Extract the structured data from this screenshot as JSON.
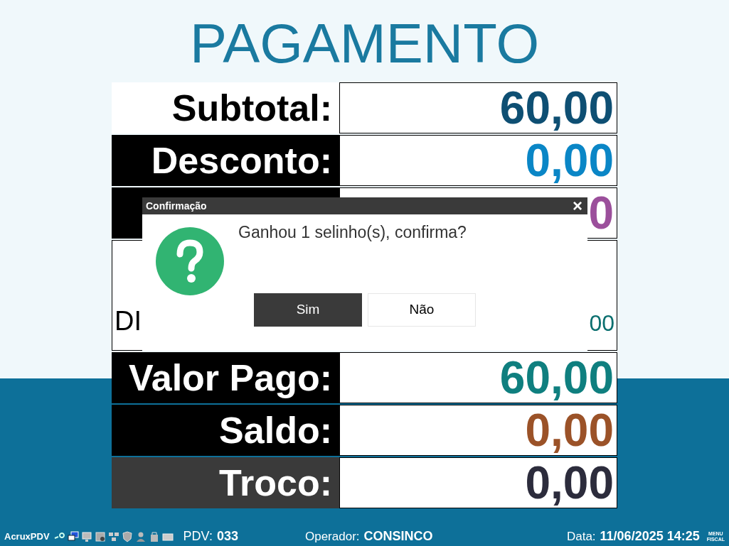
{
  "title": "PAGAMENTO",
  "rows": [
    {
      "kind": "plain",
      "label": "Subtotal:",
      "value": "60,00",
      "color": "#0e4f73"
    },
    {
      "kind": "dark",
      "label": "Desconto:",
      "value": "0,00",
      "color": "#0a86c6"
    },
    {
      "kind": "covered",
      "value": "0",
      "color": "#9b4f9b"
    },
    {
      "kind": "tall",
      "label": "DI",
      "value": "00",
      "color": "#0b6f6f"
    },
    {
      "kind": "dark",
      "label": "Valor Pago:",
      "value": "60,00",
      "color": "#0f7f7f"
    },
    {
      "kind": "dark",
      "label": "Saldo:",
      "value": "0,00",
      "color": "#9b5228"
    },
    {
      "kind": "total",
      "label": "Troco:",
      "value": "0,00",
      "color": "#2c2c3c"
    }
  ],
  "dialog": {
    "title": "Confirmação",
    "close": "×",
    "message": "Ganhou 1 selinho(s), confirma?",
    "buttons": [
      {
        "label": "Sim",
        "selected": true
      },
      {
        "label": "Não",
        "selected": false
      }
    ]
  },
  "status_bar": {
    "app": "AcruxPDV",
    "pdv_label": "PDV:",
    "pdv": "033",
    "operator_label": "Operador:",
    "operator": "CONSINCO",
    "date_label": "Data:",
    "date": "11/06/2025 14:25",
    "menu_fiscal": [
      "MENU",
      "FISCAL"
    ]
  }
}
